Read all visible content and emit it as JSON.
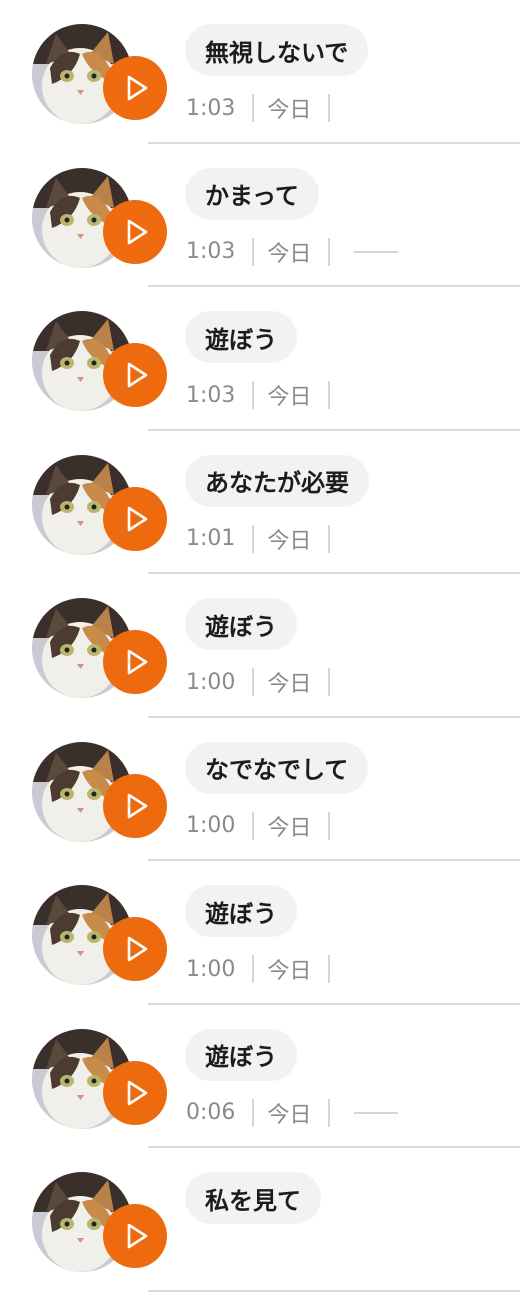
{
  "accent_color": "#ee6a0e",
  "play_icon": "play-icon",
  "messages": [
    {
      "text": "無視しないで",
      "duration": "1:03",
      "date": "今日",
      "has_dash": false
    },
    {
      "text": "かまって",
      "duration": "1:03",
      "date": "今日",
      "has_dash": true
    },
    {
      "text": "遊ぼう",
      "duration": "1:03",
      "date": "今日",
      "has_dash": false
    },
    {
      "text": "あなたが必要",
      "duration": "1:01",
      "date": "今日",
      "has_dash": false
    },
    {
      "text": "遊ぼう",
      "duration": "1:00",
      "date": "今日",
      "has_dash": false
    },
    {
      "text": "なでなでして",
      "duration": "1:00",
      "date": "今日",
      "has_dash": false
    },
    {
      "text": "遊ぼう",
      "duration": "1:00",
      "date": "今日",
      "has_dash": false
    },
    {
      "text": "遊ぼう",
      "duration": "0:06",
      "date": "今日",
      "has_dash": true
    },
    {
      "text": "私を見て",
      "duration": "",
      "date": "",
      "has_dash": false
    }
  ]
}
